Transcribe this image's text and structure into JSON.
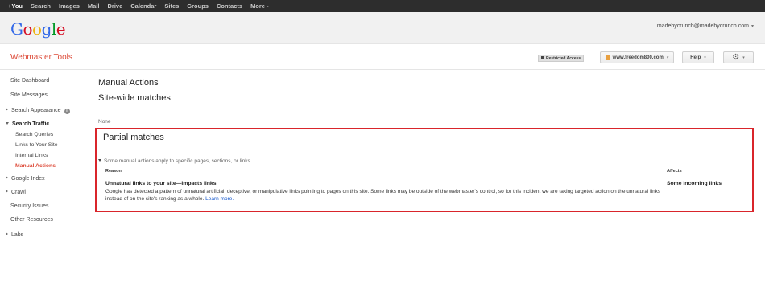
{
  "topbar": {
    "items": [
      "+You",
      "Search",
      "Images",
      "Mail",
      "Drive",
      "Calendar",
      "Sites",
      "Groups",
      "Contacts",
      "More -"
    ]
  },
  "header": {
    "logo_letters": [
      {
        "ch": "G",
        "color": "#3369e8"
      },
      {
        "ch": "o",
        "color": "#d50f25"
      },
      {
        "ch": "o",
        "color": "#eeb211"
      },
      {
        "ch": "g",
        "color": "#3369e8"
      },
      {
        "ch": "l",
        "color": "#009925"
      },
      {
        "ch": "e",
        "color": "#d50f25"
      }
    ],
    "account_email": "madebycrunch@madebycrunch.com",
    "account_caret": "▾"
  },
  "prodbar": {
    "product_name": "Webmaster Tools",
    "restricted_label": "Restricted Access",
    "site_label": "www.freedom800.com",
    "help_label": "Help",
    "caret": "▾",
    "gear_icon": "⚙"
  },
  "sidebar": {
    "site_dashboard": "Site Dashboard",
    "site_messages": "Site Messages",
    "search_appearance": "Search Appearance",
    "info_glyph": "i",
    "search_traffic": "Search Traffic",
    "search_queries": "Search Queries",
    "links_to_site": "Links to Your Site",
    "internal_links": "Internal Links",
    "manual_actions": "Manual Actions",
    "google_index": "Google Index",
    "crawl": "Crawl",
    "security_issues": "Security Issues",
    "other_resources": "Other Resources",
    "labs": "Labs"
  },
  "main": {
    "title": "Manual Actions",
    "sitewide_heading": "Site-wide matches",
    "sitewide_value": "None",
    "partial_heading": "Partial matches",
    "disclosure_text": "Some manual actions apply to specific pages, sections, or links",
    "col_reason": "Reason",
    "col_affects": "Affects",
    "reason_title": "Unnatural links to your site—impacts links",
    "reason_desc": "Google has detected a pattern of unnatural artificial, deceptive, or manipulative links pointing to pages on this site. Some links may be outside of the webmaster's control, so for this incident we are taking targeted action on the unnatural links instead of on the site's ranking as a whole.",
    "learn_more": "Learn more.",
    "affects_value": "Some incoming links"
  }
}
